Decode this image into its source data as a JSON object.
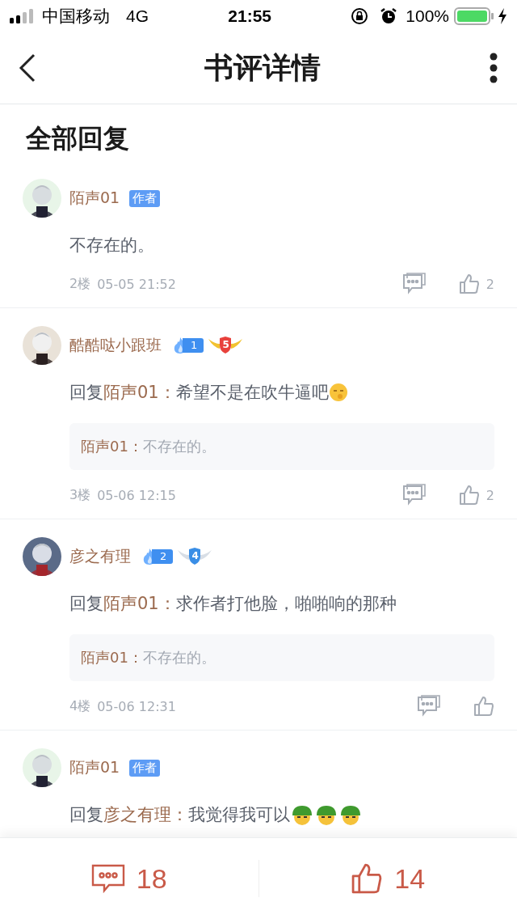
{
  "status_bar": {
    "carrier": "中国移动",
    "network": "4G",
    "time": "21:55",
    "battery_text": "100%"
  },
  "nav": {
    "title": "书评详情"
  },
  "section_title": "全部回复",
  "replies": [
    {
      "name": "陌声01",
      "badges": [
        {
          "kind": "author",
          "label": "作者"
        }
      ],
      "body": {
        "text": "不存在的。"
      },
      "floor": "2楼",
      "time": "05-05 21:52",
      "likes": "2"
    },
    {
      "name": "酷酷哒小跟班",
      "badges": [
        {
          "kind": "fire",
          "label": "1"
        },
        {
          "kind": "medal",
          "label": "5",
          "color": "#e8413c"
        }
      ],
      "body": {
        "prefix": "回复",
        "target": "陌声01：",
        "text": "希望不是在吹牛逼吧"
      },
      "emoji": [
        {
          "kind": "shush"
        }
      ],
      "quote": {
        "author": "陌声01：",
        "text": "不存在的。"
      },
      "floor": "3楼",
      "time": "05-06 12:15",
      "likes": "2"
    },
    {
      "name": "彦之有理",
      "badges": [
        {
          "kind": "fire",
          "label": "2"
        },
        {
          "kind": "medal",
          "label": "4",
          "color": "#3a8ee6"
        }
      ],
      "body": {
        "prefix": "回复",
        "target": "陌声01：",
        "text": "求作者打他脸，啪啪响的那种"
      },
      "quote": {
        "author": "陌声01：",
        "text": "不存在的。"
      },
      "floor": "4楼",
      "time": "05-06 12:31"
    },
    {
      "name": "陌声01",
      "badges": [
        {
          "kind": "author",
          "label": "作者"
        }
      ],
      "body": {
        "prefix": "回复",
        "target": "彦之有理：",
        "text": "我觉得我可以"
      },
      "emoji": [
        {
          "kind": "helmet"
        },
        {
          "kind": "helmet"
        },
        {
          "kind": "helmet"
        }
      ]
    }
  ],
  "bottom_bar": {
    "comments": "18",
    "likes": "14"
  }
}
